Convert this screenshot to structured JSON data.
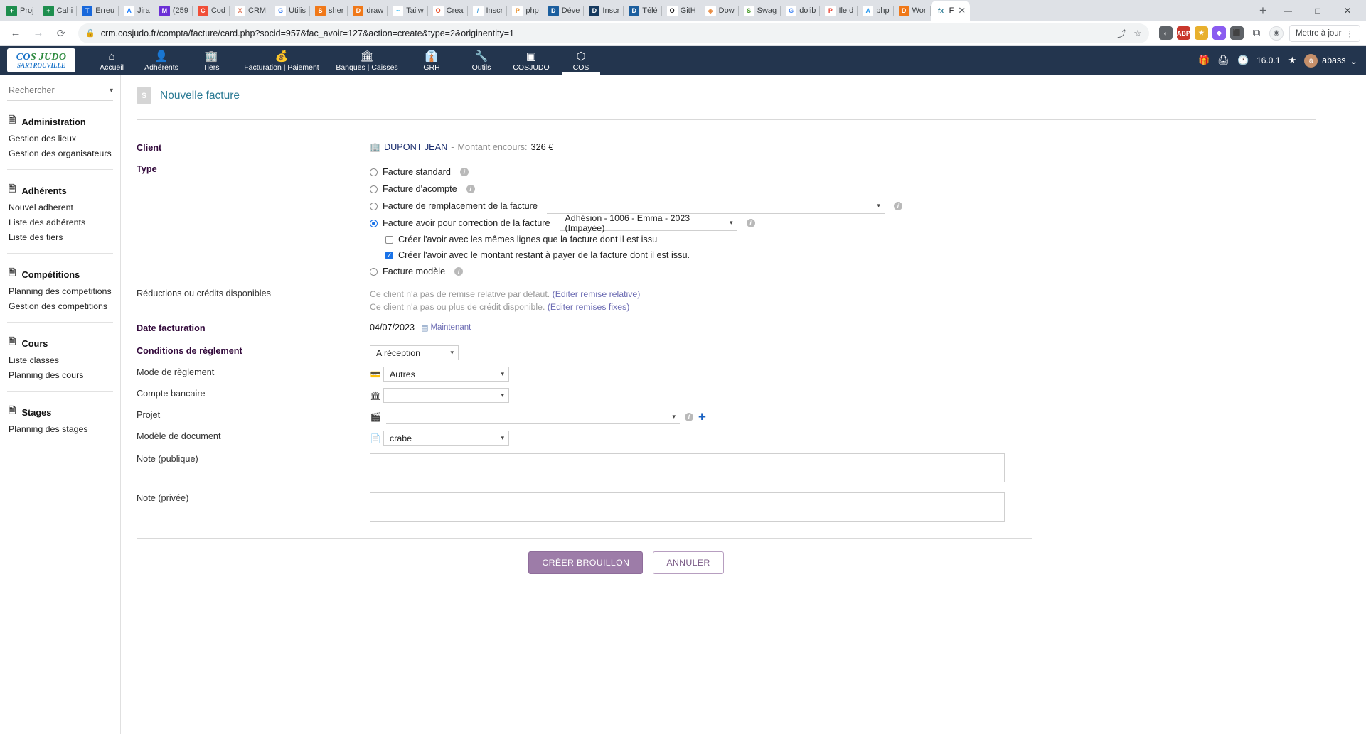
{
  "browser": {
    "tabs": [
      {
        "label": "Proj",
        "fav": "+",
        "favbg": "#1e8e4e"
      },
      {
        "label": "Cahi",
        "fav": "+",
        "favbg": "#1e8e4e"
      },
      {
        "label": "Erreu",
        "fav": "T",
        "favbg": "#1868db"
      },
      {
        "label": "Jira",
        "fav": "A",
        "favbg": "#ffffff",
        "favcolor": "#2684ff"
      },
      {
        "label": "(259",
        "fav": "M",
        "favbg": "#6b2fd6"
      },
      {
        "label": "Cod",
        "fav": "C",
        "favbg": "#f04e38"
      },
      {
        "label": "CRM",
        "fav": "X",
        "favbg": "#ffffff",
        "favcolor": "#e07a5f"
      },
      {
        "label": "Utilis",
        "fav": "G",
        "favbg": "#ffffff",
        "favcolor": "#4285f4"
      },
      {
        "label": "sher",
        "fav": "S",
        "favbg": "#f07818"
      },
      {
        "label": "draw",
        "fav": "D",
        "favbg": "#f07818"
      },
      {
        "label": "Tailw",
        "fav": "~",
        "favbg": "#ffffff",
        "favcolor": "#38bdf8"
      },
      {
        "label": "Crea",
        "fav": "O",
        "favbg": "#ffffff",
        "favcolor": "#e8512c"
      },
      {
        "label": "Inscr",
        "fav": "/",
        "favbg": "#ffffff",
        "favcolor": "#4aa3df"
      },
      {
        "label": "php",
        "fav": "P",
        "favbg": "#ffffff",
        "favcolor": "#e8912d"
      },
      {
        "label": "Déve",
        "fav": "D",
        "favbg": "#1b5e9e"
      },
      {
        "label": "Inscr",
        "fav": "D",
        "favbg": "#15395e"
      },
      {
        "label": "Télé",
        "fav": "D",
        "favbg": "#1b5e9e"
      },
      {
        "label": "GitH",
        "fav": "O",
        "favbg": "#ffffff",
        "favcolor": "#181717"
      },
      {
        "label": "Dow",
        "fav": "◈",
        "favbg": "#ffffff",
        "favcolor": "#e8873a"
      },
      {
        "label": "Swag",
        "fav": "S",
        "favbg": "#ffffff",
        "favcolor": "#4a9c2d"
      },
      {
        "label": "dolib",
        "fav": "G",
        "favbg": "#ffffff",
        "favcolor": "#4285f4"
      },
      {
        "label": "Ile d",
        "fav": "P",
        "favbg": "#ffffff",
        "favcolor": "#ea4335"
      },
      {
        "label": "php",
        "fav": "A",
        "favbg": "#ffffff",
        "favcolor": "#2c9bf0"
      },
      {
        "label": "Wor",
        "fav": "D",
        "favbg": "#f07818"
      }
    ],
    "active_tab": {
      "label": "F",
      "fav": "fx",
      "favbg": "#ffffff",
      "favcolor": "#2b7a94"
    },
    "new_tab_label": "+",
    "window_minimize": "—",
    "window_maximize": "□",
    "window_close": "✕",
    "back_icon": "←",
    "forward_icon": "→",
    "reload_icon": "⟳",
    "lock_icon": "🔒",
    "url": "crm.cosjudo.fr/compta/facture/card.php?socid=957&fac_avoir=127&action=create&type=2&originentity=1",
    "share_icon": "⤴",
    "star_icon": "☆",
    "extensions": [
      {
        "glyph": "◐",
        "bg": "#5f6368"
      },
      {
        "glyph": "ABP",
        "bg": "#c9372c"
      },
      {
        "glyph": "★",
        "bg": "#e8b02d"
      },
      {
        "glyph": "◆",
        "bg": "#8a5cf0"
      },
      {
        "glyph": "⬛",
        "bg": "#5f6368"
      }
    ],
    "puzzle_icon": "⧉",
    "update_label": "Mettre à jour",
    "update_menu_icon": "⋮",
    "profile_icon": "◉"
  },
  "appbar": {
    "logo_cos": "CO",
    "logo_slash": "S",
    "logo_judo": "JUDO",
    "logo_sub": "SARTROUVILLE",
    "items": [
      {
        "label": "Accueil",
        "icon": "home-icon",
        "glyph": "⌂",
        "width": "normal",
        "active": false
      },
      {
        "label": "Adhérents",
        "icon": "user-icon",
        "glyph": "👤",
        "width": "normal",
        "active": false
      },
      {
        "label": "Tiers",
        "icon": "building-icon",
        "glyph": "🏢",
        "width": "normal",
        "active": false
      },
      {
        "label": "Facturation | Paiement",
        "icon": "money-icon",
        "glyph": "💰",
        "width": "wide",
        "active": false
      },
      {
        "label": "Banques | Caisses",
        "icon": "bank-icon",
        "glyph": "🏛",
        "width": "wide2",
        "active": false
      },
      {
        "label": "GRH",
        "icon": "hr-icon",
        "glyph": "👔",
        "width": "normal",
        "active": false
      },
      {
        "label": "Outils",
        "icon": "tools-icon",
        "glyph": "🔧",
        "width": "normal",
        "active": false
      },
      {
        "label": "COSJUDO",
        "icon": "module-icon",
        "glyph": "▣",
        "width": "normal",
        "active": false
      },
      {
        "label": "COS",
        "icon": "module-icon",
        "glyph": "⬡",
        "width": "normal",
        "active": true
      }
    ],
    "right": {
      "gift_icon": "🎁",
      "print_icon": "🖨",
      "clock_icon": "🕐",
      "version": "16.0.1",
      "star_icon": "★",
      "user_name": "abass",
      "user_caret": "⌄",
      "user_initial": "a"
    }
  },
  "sidebar": {
    "search_placeholder": "Rechercher",
    "search_value": "",
    "search_caret": "▾",
    "groups": [
      {
        "title": "Administration",
        "icon_glyph": "🗎",
        "links": [
          "Gestion des lieux",
          "Gestion des organisateurs"
        ]
      },
      {
        "title": "Adhérents",
        "icon_glyph": "🗎",
        "links": [
          "Nouvel adherent",
          "Liste des adhérents",
          "Liste des tiers"
        ]
      },
      {
        "title": "Compétitions",
        "icon_glyph": "🗎",
        "links": [
          "Planning des competitions",
          "Gestion des competitions"
        ]
      },
      {
        "title": "Cours",
        "icon_glyph": "🗎",
        "links": [
          "Liste classes",
          "Planning des cours"
        ]
      },
      {
        "title": "Stages",
        "icon_glyph": "🗎",
        "links": [
          "Planning des stages"
        ]
      }
    ]
  },
  "page": {
    "title": "Nouvelle facture",
    "doc_icon_glyph": "$"
  },
  "form": {
    "client": {
      "label": "Client",
      "building_icon": "🏢",
      "name": "DUPONT JEAN",
      "dash": "-",
      "outstanding_label": "Montant encours:",
      "outstanding_value": "326 €"
    },
    "type": {
      "label": "Type",
      "options": [
        {
          "label": "Facture standard",
          "selected": false,
          "has_info": true
        },
        {
          "label": "Facture d'acompte",
          "selected": false,
          "has_info": true
        },
        {
          "label": "Facture de remplacement de la facture",
          "selected": false,
          "has_info": true,
          "has_select": true,
          "select_value": ""
        },
        {
          "label": "Facture avoir pour correction de la facture",
          "selected": true,
          "has_info": true,
          "has_select": true,
          "select_value": "Adhésion - 1006 - Emma - 2023 (Impayée)"
        },
        {
          "label": "Facture modèle",
          "selected": false,
          "has_info": true
        }
      ],
      "sub_checkboxes": [
        {
          "label": "Créer l'avoir avec les mêmes lignes que la facture dont il est issu",
          "checked": false
        },
        {
          "label": "Créer l'avoir avec le montant restant à payer de la facture dont il est issu.",
          "checked": true
        }
      ]
    },
    "discounts": {
      "label": "Réductions ou crédits disponibles",
      "line1_text": "Ce client n'a pas de remise relative par défaut.",
      "line1_link": "(Editer remise relative)",
      "line2_text": "Ce client n'a pas ou plus de crédit disponible.",
      "line2_link": "(Editer remises fixes)"
    },
    "invoice_date": {
      "label": "Date facturation",
      "value": "04/07/2023",
      "now_icon": "▤",
      "now_label": "Maintenant"
    },
    "payment_terms": {
      "label": "Conditions de règlement",
      "value": "A réception",
      "caret": "▾"
    },
    "payment_mode": {
      "label": "Mode de règlement",
      "icon": "💳",
      "value": "Autres",
      "caret": "▾"
    },
    "bank_account": {
      "label": "Compte bancaire",
      "icon": "🏛",
      "value": "",
      "caret": "▾"
    },
    "project": {
      "label": "Projet",
      "icon": "🎬",
      "value": "",
      "caret": "▾",
      "info_icon": "i",
      "add_icon": "✚"
    },
    "doc_model": {
      "label": "Modèle de document",
      "icon": "📄",
      "value": "crabe",
      "caret": "▾"
    },
    "note_public": {
      "label": "Note (publique)",
      "value": ""
    },
    "note_private": {
      "label": "Note (privée)",
      "value": ""
    }
  },
  "actions": {
    "submit_label": "Créer brouillon",
    "cancel_label": "Annuler"
  }
}
